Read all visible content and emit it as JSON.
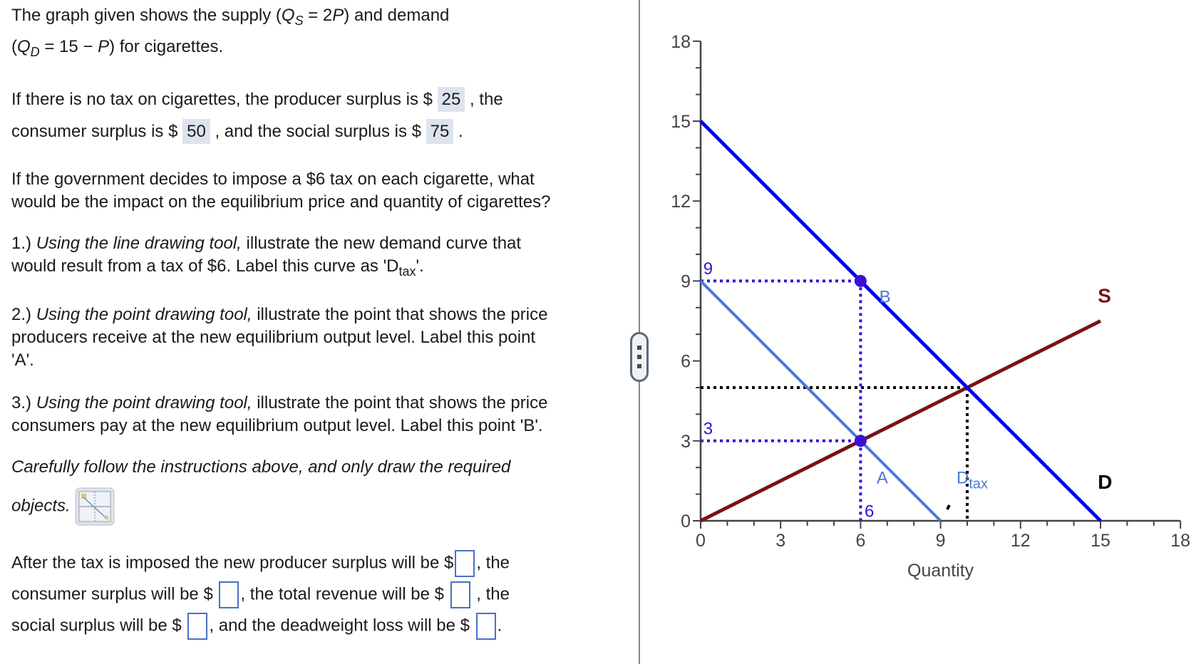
{
  "question": {
    "intro_line1_pre": "The graph given shows the supply (",
    "qs_symbol": "Q",
    "qs_sub": "S",
    "qs_eq": " = 2",
    "qs_p": "P",
    "intro_line1_post": ") and demand",
    "qd_open": "(",
    "qd_symbol": "Q",
    "qd_sub": "D",
    "qd_eq": " = 15 − ",
    "qd_p": "P",
    "intro_line2_post": ") for cigarettes.",
    "notax_1": "If there is no tax on cigarettes, the producer surplus is $ ",
    "producer_surplus": "25",
    "notax_2": " , the",
    "notax_3": "consumer surplus is $ ",
    "consumer_surplus": "50",
    "notax_4": " , and the social surplus is $ ",
    "social_surplus": "75",
    "notax_5": " .",
    "tax_q1": "If the government decides to impose a $6 tax on each cigarette, what",
    "tax_q2": "would be the impact on the equilibrium price and quantity of cigarettes?",
    "step1_num": "1.) ",
    "step1_tool": "Using the line drawing tool,",
    "step1_rest": " illustrate the new demand curve that",
    "step1_line2": "would result from a tax of $6. Label this curve as 'D",
    "step1_sub": "tax",
    "step1_end": "'.",
    "step2_num": "2.) ",
    "step2_tool": "Using the point drawing tool,",
    "step2_rest": " illustrate the point that shows the price",
    "step2_line2": "producers receive at the new equilibrium output level. Label this point",
    "step2_line3": "'A'.",
    "step3_num": "3.) ",
    "step3_tool": "Using the point drawing tool,",
    "step3_rest": " illustrate the point that shows the price",
    "step3_line2": "consumers pay at the new equilibrium output level. Label this point 'B'.",
    "careful_1": "Carefully follow the instructions above, and only draw the required",
    "careful_2": "objects.",
    "after_1": "After the tax is imposed the new producer surplus will be $",
    "after_2": ", the",
    "after_3": "consumer surplus will be $ ",
    "after_4": ", the total revenue will be $ ",
    "after_5": " , the",
    "after_6": "social surplus will be $ ",
    "after_7": ", and the deadweight loss will be $ ",
    "after_8": ".",
    "answers": {
      "producer_surplus": "",
      "consumer_surplus": "",
      "total_revenue": "",
      "social_surplus": "",
      "deadweight_loss": ""
    }
  },
  "chart_data": {
    "type": "line",
    "title": "",
    "xlabel": "Quantity",
    "ylabel": "",
    "xlim": [
      0,
      18
    ],
    "ylim": [
      0,
      18
    ],
    "x_ticks": [
      0,
      3,
      6,
      9,
      12,
      15,
      18
    ],
    "y_ticks": [
      0,
      3,
      6,
      9,
      12,
      15,
      18
    ],
    "minor_tick_step": 1,
    "grid": false,
    "series": [
      {
        "name": "S",
        "color": "#7a1212",
        "points": [
          [
            0,
            0
          ],
          [
            15,
            7.5
          ]
        ]
      },
      {
        "name": "D",
        "color": "#0000ee",
        "points": [
          [
            0,
            15
          ],
          [
            15,
            0
          ]
        ]
      },
      {
        "name": "Dtax",
        "color": "#4a78d8",
        "points": [
          [
            0,
            9
          ],
          [
            9,
            0
          ]
        ]
      }
    ],
    "points": [
      {
        "name": "B",
        "x": 6,
        "y": 9,
        "color": "#3a10d8"
      },
      {
        "name": "A",
        "x": 6,
        "y": 3,
        "color": "#3a10d8"
      }
    ],
    "guide_lines": [
      {
        "color": "#3a10d8",
        "points": [
          [
            0,
            9
          ],
          [
            6,
            9
          ]
        ]
      },
      {
        "color": "#3a10d8",
        "points": [
          [
            0,
            3
          ],
          [
            6,
            3
          ]
        ]
      },
      {
        "color": "#3a10d8",
        "points": [
          [
            6,
            9
          ],
          [
            6,
            0
          ]
        ]
      },
      {
        "color": "#000000",
        "points": [
          [
            0,
            5
          ],
          [
            10,
            5
          ]
        ]
      },
      {
        "color": "#000000",
        "points": [
          [
            10,
            5
          ],
          [
            10,
            0
          ]
        ]
      }
    ],
    "annotations": [
      {
        "text": "S",
        "x": 14.9,
        "y": 8.2,
        "color": "#7a1212",
        "bold": true
      },
      {
        "text": "D",
        "x": 14.9,
        "y": 1.2,
        "color": "#000000",
        "bold": true
      },
      {
        "text": "B",
        "x": 6.7,
        "y": 8.2,
        "color": "#4a78d8"
      },
      {
        "text": "A",
        "x": 6.6,
        "y": 1.4,
        "color": "#4a78d8"
      },
      {
        "text": "D",
        "sub": "tax",
        "x": 9.6,
        "y": 1.4,
        "color": "#4a78d8"
      },
      {
        "text": "9",
        "x": 0.1,
        "y": 9.25,
        "color": "#3a10d8"
      },
      {
        "text": "3",
        "x": 0.1,
        "y": 3.25,
        "color": "#3a10d8"
      },
      {
        "text": "6",
        "x": 6.15,
        "y": 0.15,
        "color": "#3a10d8"
      }
    ]
  }
}
